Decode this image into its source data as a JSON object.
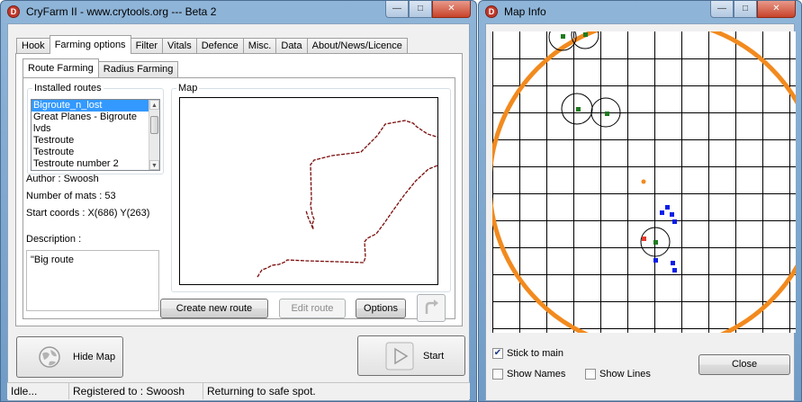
{
  "main_window": {
    "title": "CryFarm II - www.crytools.org  --- Beta 2",
    "icon_letter": "D",
    "controls": {
      "minimize": "—",
      "maximize": "□",
      "close": "✕"
    },
    "tabs": [
      "Hook",
      "Farming options",
      "Filter",
      "Vitals",
      "Defence",
      "Misc.",
      "Data",
      "About/News/Licence"
    ],
    "active_tab": "Farming options",
    "subtabs": [
      "Route Farming",
      "Radius Farming"
    ],
    "active_subtab": "Route Farming",
    "installed_routes": {
      "label": "Installed routes",
      "items": [
        "Bigroute_n_lost",
        "Great Planes - Bigroute",
        "lvds",
        "Testroute",
        "Testroute",
        "Testroute number 2"
      ],
      "selected_index": 0
    },
    "author": "Author : Swoosh",
    "mats": "Number of mats : 53",
    "start_coords": "Start coords : X(686) Y(263)",
    "description_label": "Description :",
    "description": "\"Big route",
    "map_label": "Map",
    "buttons": {
      "create_route": "Create new route",
      "edit_route": "Edit route",
      "options": "Options",
      "hide_map": "Hide Map",
      "start": "Start"
    },
    "status": [
      "Idle...",
      "Registered to : Swoosh",
      "Returning to safe spot."
    ]
  },
  "map_info_window": {
    "title": "Map Info",
    "icon_letter": "D",
    "controls": {
      "minimize": "—",
      "maximize": "□",
      "close": "✕"
    },
    "checkboxes": [
      {
        "label": "Stick to main",
        "checked": true
      },
      {
        "label": "Show Names",
        "checked": false
      },
      {
        "label": "Show Lines",
        "checked": false
      }
    ],
    "close_button": "Close"
  },
  "colors": {
    "range_circle": "#f28a1e",
    "mat_marker": "#1e7a1e",
    "player_marker": "#e53a2a",
    "other_marker": "#0a1ee8",
    "route_line": "#7a0a0a"
  }
}
